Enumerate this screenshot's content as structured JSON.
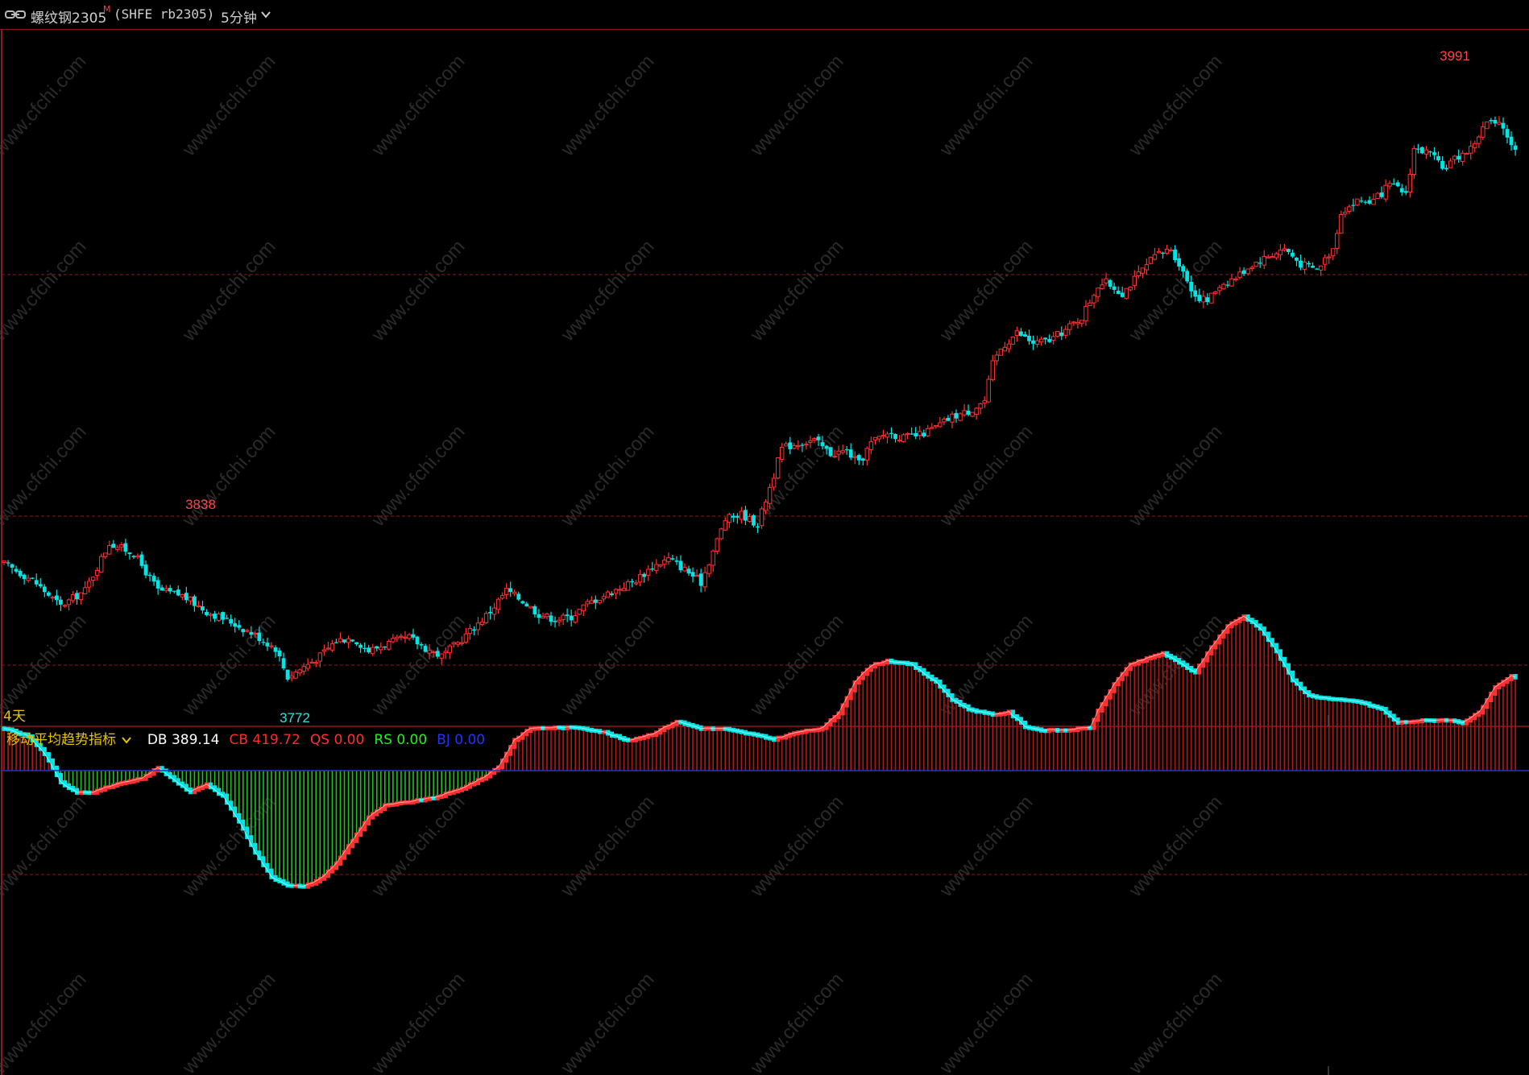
{
  "header": {
    "symbol_name": "螺纹钢2305",
    "main_badge": "M",
    "contract_code": "(SHFE rb2305)",
    "period": "5分钟"
  },
  "price_panel": {
    "high_label": "3991",
    "local_high_label": "3838",
    "low_label": "3772",
    "day_marker": "4天"
  },
  "indicator": {
    "name": "移动平均趋势指标",
    "items": [
      {
        "key": "DB",
        "value": "389.14",
        "color": "#ffffff"
      },
      {
        "key": "CB",
        "value": "419.72",
        "color": "#ff2a2a"
      },
      {
        "key": "QS",
        "value": "0.00",
        "color": "#ff3030"
      },
      {
        "key": "RS",
        "value": "0.00",
        "color": "#22ee22"
      },
      {
        "key": "BJ",
        "value": "0.00",
        "color": "#2233ff"
      }
    ]
  },
  "watermark": "www.cfchi.com",
  "colors": {
    "up": "#ff3030",
    "down": "#00e5e5",
    "grid": "#8b1a1a",
    "hist_pos": "#b01818",
    "hist_neg": "#20c020",
    "zero_line": "#2233cc",
    "label_red": "#ff4444",
    "label_cyan": "#33e0e0",
    "day_marker": "#e8c400"
  },
  "chart_data": [
    {
      "type": "candlestick",
      "title": "螺纹钢2305 5分钟",
      "ylim": [
        3760,
        4000
      ],
      "annotations": [
        {
          "text": "3838",
          "value": 3838
        },
        {
          "text": "3991",
          "value": 3991
        },
        {
          "text": "3772",
          "value": 3772
        }
      ],
      "close_path": [
        [
          0,
          3818
        ],
        [
          7,
          3812
        ],
        [
          14,
          3802
        ],
        [
          20,
          3808
        ],
        [
          26,
          3826
        ],
        [
          32,
          3822
        ],
        [
          38,
          3808
        ],
        [
          44,
          3806
        ],
        [
          50,
          3800
        ],
        [
          56,
          3796
        ],
        [
          62,
          3791
        ],
        [
          67,
          3786
        ],
        [
          70,
          3775
        ],
        [
          74,
          3779
        ],
        [
          78,
          3783
        ],
        [
          82,
          3789
        ],
        [
          86,
          3790
        ],
        [
          90,
          3785
        ],
        [
          95,
          3788
        ],
        [
          100,
          3790
        ],
        [
          104,
          3786
        ],
        [
          108,
          3783
        ],
        [
          112,
          3788
        ],
        [
          116,
          3794
        ],
        [
          120,
          3800
        ],
        [
          124,
          3808
        ],
        [
          128,
          3804
        ],
        [
          132,
          3799
        ],
        [
          136,
          3797
        ],
        [
          140,
          3798
        ],
        [
          144,
          3803
        ],
        [
          148,
          3806
        ],
        [
          152,
          3809
        ],
        [
          156,
          3812
        ],
        [
          160,
          3817
        ],
        [
          164,
          3820
        ],
        [
          168,
          3816
        ],
        [
          172,
          3811
        ],
        [
          175,
          3823
        ],
        [
          178,
          3835
        ],
        [
          182,
          3837
        ],
        [
          186,
          3833
        ],
        [
          190,
          3852
        ],
        [
          192,
          3862
        ],
        [
          196,
          3864
        ],
        [
          200,
          3865
        ],
        [
          204,
          3860
        ],
        [
          208,
          3861
        ],
        [
          211,
          3856
        ],
        [
          214,
          3864
        ],
        [
          218,
          3868
        ],
        [
          222,
          3866
        ],
        [
          226,
          3867
        ],
        [
          230,
          3870
        ],
        [
          234,
          3874
        ],
        [
          238,
          3876
        ],
        [
          242,
          3880
        ],
        [
          244,
          3894
        ],
        [
          246,
          3900
        ],
        [
          250,
          3906
        ],
        [
          254,
          3902
        ],
        [
          258,
          3903
        ],
        [
          262,
          3907
        ],
        [
          266,
          3912
        ],
        [
          268,
          3918
        ],
        [
          270,
          3924
        ],
        [
          272,
          3925
        ],
        [
          276,
          3921
        ],
        [
          280,
          3928
        ],
        [
          284,
          3935
        ],
        [
          288,
          3938
        ],
        [
          291,
          3929
        ],
        [
          294,
          3920
        ],
        [
          297,
          3918
        ],
        [
          300,
          3924
        ],
        [
          304,
          3927
        ],
        [
          308,
          3932
        ],
        [
          312,
          3935
        ],
        [
          316,
          3938
        ],
        [
          320,
          3932
        ],
        [
          324,
          3930
        ],
        [
          328,
          3938
        ],
        [
          330,
          3952
        ],
        [
          334,
          3956
        ],
        [
          338,
          3956
        ],
        [
          342,
          3962
        ],
        [
          346,
          3959
        ],
        [
          348,
          3976
        ],
        [
          352,
          3974
        ],
        [
          355,
          3968
        ],
        [
          358,
          3972
        ],
        [
          362,
          3976
        ],
        [
          366,
          3986
        ],
        [
          370,
          3984
        ],
        [
          373,
          3975
        ]
      ],
      "series_summary": {
        "start": 3818,
        "low": 3772,
        "high": 3991,
        "end": 3986
      }
    },
    {
      "type": "histogram_with_line",
      "title": "移动平均趋势指标",
      "zero": 0,
      "ylim": [
        -300,
        200
      ],
      "values_path": [
        [
          0,
          110
        ],
        [
          6,
          90
        ],
        [
          10,
          45
        ],
        [
          14,
          -30
        ],
        [
          18,
          -55
        ],
        [
          22,
          -55
        ],
        [
          26,
          -40
        ],
        [
          30,
          -30
        ],
        [
          34,
          -20
        ],
        [
          38,
          8
        ],
        [
          41,
          -15
        ],
        [
          46,
          -55
        ],
        [
          50,
          -35
        ],
        [
          54,
          -65
        ],
        [
          58,
          -130
        ],
        [
          62,
          -210
        ],
        [
          66,
          -275
        ],
        [
          70,
          -295
        ],
        [
          74,
          -300
        ],
        [
          78,
          -280
        ],
        [
          82,
          -240
        ],
        [
          86,
          -180
        ],
        [
          90,
          -120
        ],
        [
          94,
          -90
        ],
        [
          100,
          -80
        ],
        [
          106,
          -70
        ],
        [
          112,
          -50
        ],
        [
          118,
          -20
        ],
        [
          122,
          10
        ],
        [
          126,
          80
        ],
        [
          130,
          110
        ],
        [
          136,
          112
        ],
        [
          142,
          112
        ],
        [
          148,
          100
        ],
        [
          154,
          78
        ],
        [
          160,
          95
        ],
        [
          166,
          128
        ],
        [
          172,
          110
        ],
        [
          178,
          108
        ],
        [
          184,
          96
        ],
        [
          190,
          82
        ],
        [
          196,
          100
        ],
        [
          202,
          110
        ],
        [
          206,
          150
        ],
        [
          210,
          230
        ],
        [
          214,
          272
        ],
        [
          218,
          285
        ],
        [
          224,
          275
        ],
        [
          230,
          230
        ],
        [
          234,
          185
        ],
        [
          238,
          160
        ],
        [
          244,
          145
        ],
        [
          248,
          152
        ],
        [
          252,
          115
        ],
        [
          256,
          105
        ],
        [
          262,
          105
        ],
        [
          268,
          112
        ],
        [
          270,
          155
        ],
        [
          274,
          225
        ],
        [
          278,
          275
        ],
        [
          282,
          290
        ],
        [
          286,
          305
        ],
        [
          290,
          280
        ],
        [
          294,
          255
        ],
        [
          298,
          320
        ],
        [
          302,
          375
        ],
        [
          306,
          400
        ],
        [
          310,
          370
        ],
        [
          314,
          310
        ],
        [
          318,
          235
        ],
        [
          322,
          195
        ],
        [
          328,
          185
        ],
        [
          334,
          180
        ],
        [
          340,
          160
        ],
        [
          344,
          125
        ],
        [
          350,
          130
        ],
        [
          356,
          132
        ],
        [
          360,
          125
        ],
        [
          364,
          150
        ],
        [
          368,
          215
        ],
        [
          372,
          245
        ],
        [
          376,
          230
        ]
      ]
    }
  ]
}
